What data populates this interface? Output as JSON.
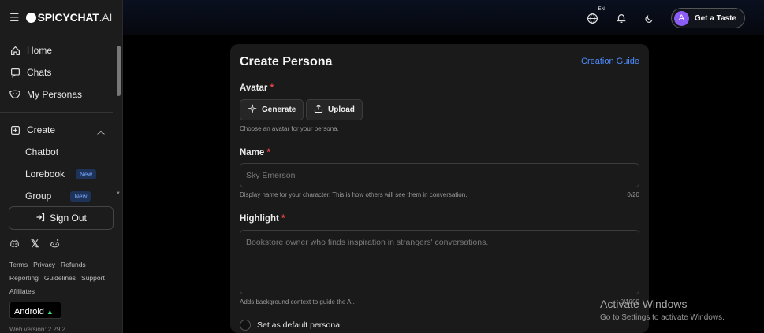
{
  "brand": {
    "name": "SPICYCHAT",
    "suffix": ".AI"
  },
  "sidebar": {
    "nav": [
      {
        "label": "Home",
        "icon": "home-icon"
      },
      {
        "label": "Chats",
        "icon": "chat-icon"
      },
      {
        "label": "My Personas",
        "icon": "mask-icon"
      }
    ],
    "create": {
      "label": "Create",
      "icon": "plus-square-icon"
    },
    "sub_items": [
      {
        "label": "Chatbot",
        "badge": ""
      },
      {
        "label": "Lorebook",
        "badge": "New"
      },
      {
        "label": "Group",
        "badge": "New"
      }
    ],
    "sign_out": "Sign Out",
    "links": [
      "Terms",
      "Privacy",
      "Refunds",
      "Reporting",
      "Guidelines",
      "Support",
      "Affiliates"
    ],
    "android_badge": "Android",
    "version": "Web version: 2.29.2"
  },
  "header": {
    "lang_code": "EN",
    "user_initial": "A",
    "cta_label": "Get a Taste"
  },
  "form": {
    "title": "Create Persona",
    "guide_link": "Creation Guide",
    "avatar": {
      "label": "Avatar",
      "generate_label": "Generate",
      "upload_label": "Upload",
      "hint": "Choose an avatar for your persona."
    },
    "name": {
      "label": "Name",
      "placeholder": "Sky Emerson",
      "hint": "Display name for your character. This is how others will see them in conversation.",
      "counter": "0/20"
    },
    "highlight": {
      "label": "Highlight",
      "placeholder": "Bookstore owner who finds inspiration in strangers' conversations.",
      "hint": "Adds background context to guide the AI.",
      "counter": "0/1000"
    },
    "default_checkbox": "Set as default persona",
    "required_mark": "*"
  },
  "watermark": {
    "title": "Activate Windows",
    "subtitle": "Go to Settings to activate Windows."
  },
  "colors": {
    "accent": "#4f8cff",
    "required": "#ef4444",
    "avatar_bg": "#8b5cf6"
  }
}
